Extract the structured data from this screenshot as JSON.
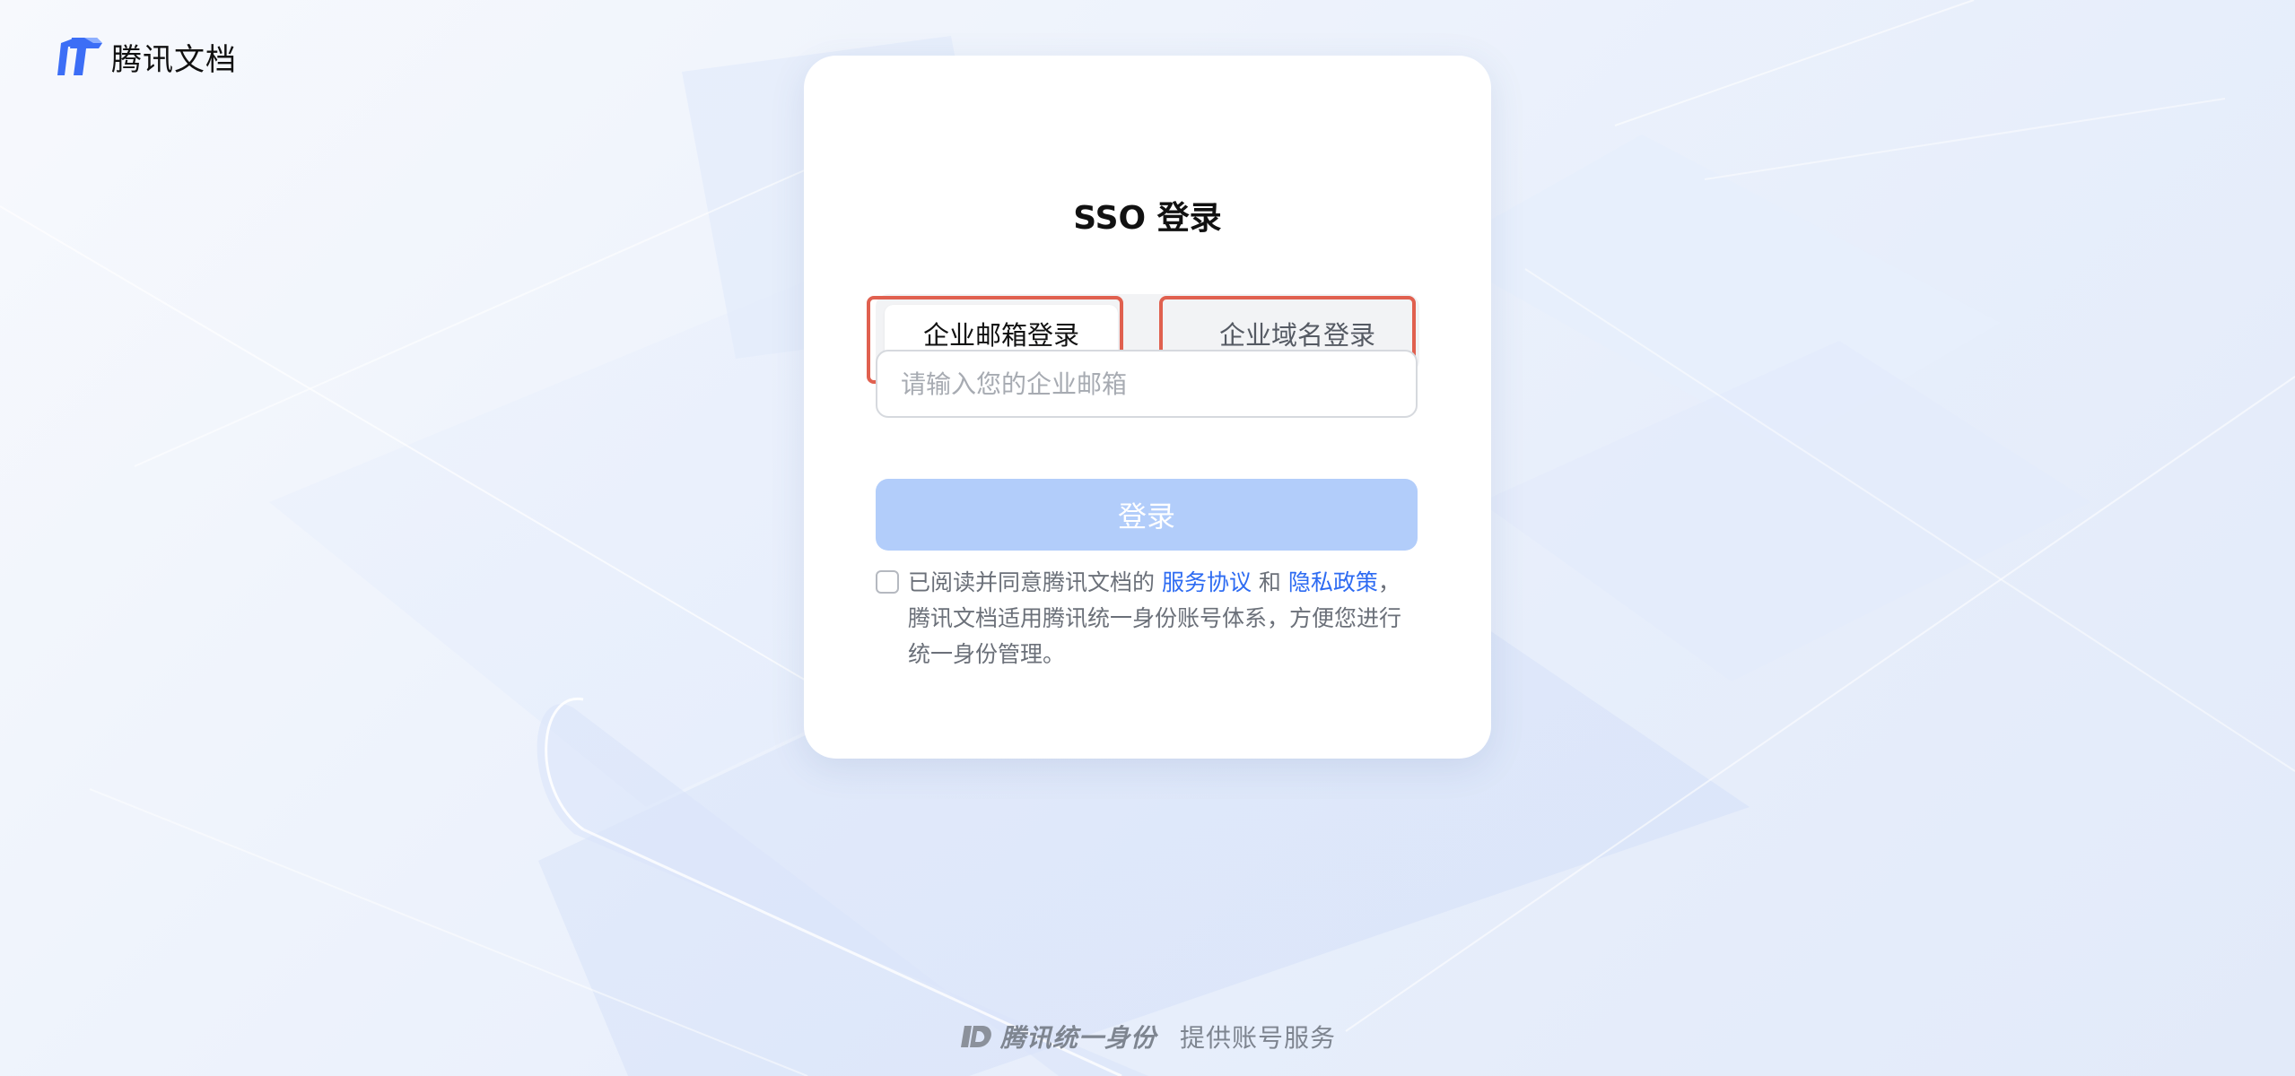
{
  "app": {
    "logo_text": "腾讯文档"
  },
  "login": {
    "title": "SSO 登录",
    "tabs": [
      {
        "label": "企业邮箱登录",
        "active": true
      },
      {
        "label": "企业域名登录",
        "active": false
      }
    ],
    "email_placeholder": "请输入您的企业邮箱",
    "email_value": "",
    "submit_label": "登录",
    "agreement": {
      "checked": false,
      "text_before": "已阅读并同意腾讯文档的 ",
      "terms_link": "服务协议",
      "conjunction": " 和 ",
      "privacy_link": "隐私政策",
      "text_after": "，腾讯文档适用腾讯统一身份账号体系，方便您进行统一身份管理。"
    }
  },
  "footer": {
    "brand": "腾讯统一身份",
    "text": "提供账号服务"
  },
  "colors": {
    "primary_disabled": "#b2cdfa",
    "link": "#2d6bf2",
    "highlight_border": "#e0604f",
    "logo_blue": "#3c6ef6"
  },
  "icons": {
    "logo": "tencent-docs-logo-icon",
    "footer": "tencent-id-icon"
  }
}
